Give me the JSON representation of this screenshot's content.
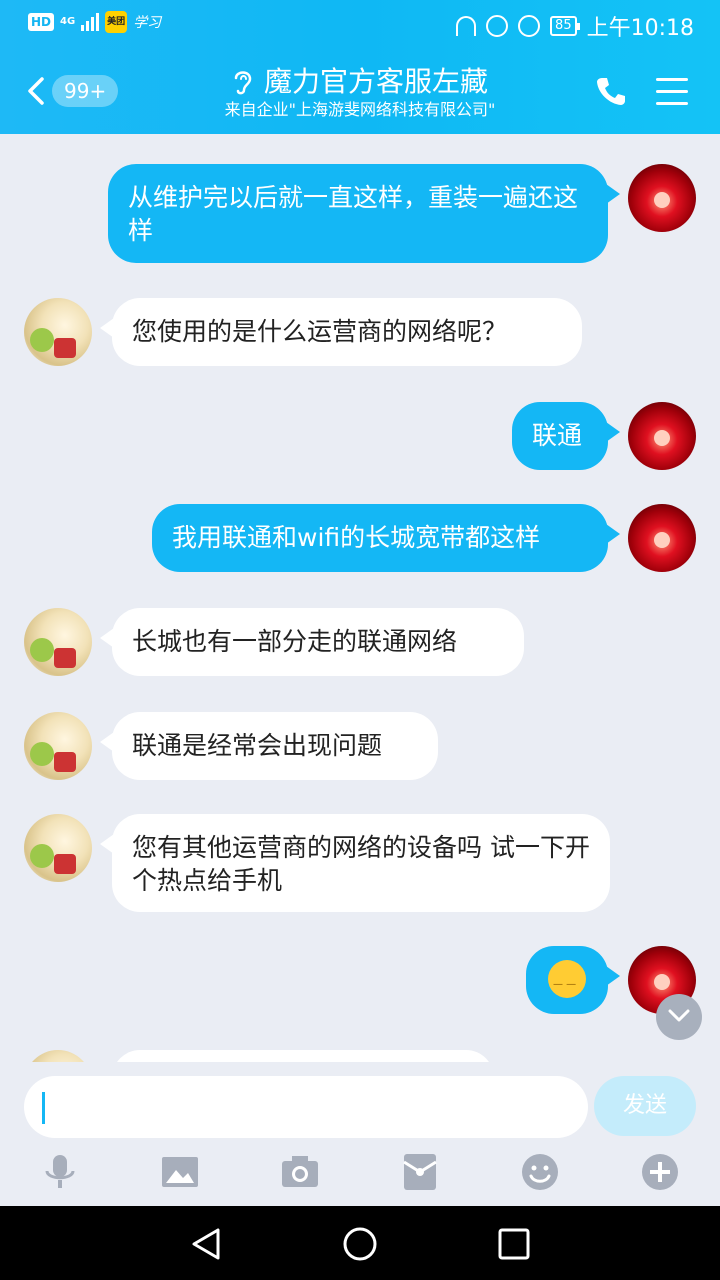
{
  "status_bar": {
    "hd": "HD",
    "network": "4G",
    "meituan": "美团",
    "study": "学习",
    "battery": "85",
    "time": "上午10:18"
  },
  "header": {
    "unread_badge": "99+",
    "title": "魔力官方客服左藏",
    "subtitle": "来自企业\"上海游斐网络科技有限公司\""
  },
  "messages": [
    {
      "side": "out",
      "text": "从维护完以后就一直这样，重装一遍还这样"
    },
    {
      "side": "in",
      "text": "您使用的是什么运营商的网络呢？"
    },
    {
      "side": "out",
      "text": "联通"
    },
    {
      "side": "out",
      "text": "我用联通和wifi的长城宽带都这样"
    },
    {
      "side": "in",
      "text": "长城也有一部分走的联通网络"
    },
    {
      "side": "in",
      "text": "联通是经常会出现问题"
    },
    {
      "side": "in",
      "text": "您有其他运营商的网络的设备吗  试一下开个热点给手机"
    },
    {
      "side": "out",
      "text": "",
      "emoji": "sweat-smile-emoji"
    }
  ],
  "input": {
    "value": "",
    "send_label": "发送"
  },
  "colors": {
    "accent": "#14b7f5",
    "background": "#eaedf4"
  }
}
